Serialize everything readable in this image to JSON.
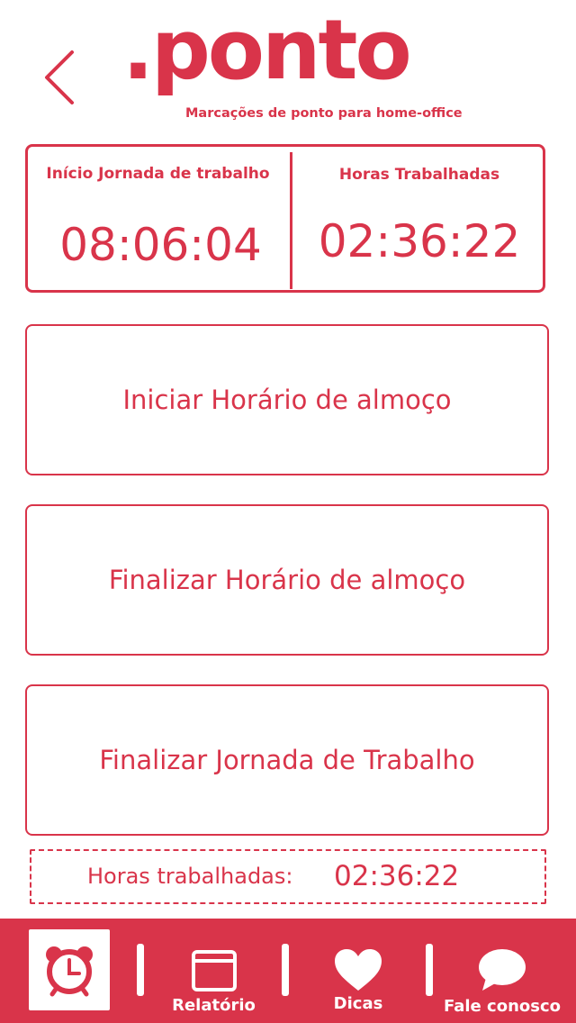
{
  "header": {
    "logo_text": ".ponto",
    "tagline": "Marcações de ponto para home-office"
  },
  "stats": {
    "start_label": "Início Jornada de trabalho",
    "start_value": "08:06:04",
    "worked_label": "Horas Trabalhadas",
    "worked_value": "02:36:22"
  },
  "actions": {
    "start_lunch": "Iniciar Horário de almoço",
    "end_lunch": "Finalizar Horário de almoço",
    "end_workday": "Finalizar Jornada de Trabalho"
  },
  "summary": {
    "label": "Horas trabalhadas:",
    "value": "02:36:22"
  },
  "nav": {
    "items": [
      {
        "icon": "alarm-clock-icon",
        "label": ""
      },
      {
        "icon": "window-icon",
        "label": "Relatório"
      },
      {
        "icon": "heart-icon",
        "label": "Dicas"
      },
      {
        "icon": "chat-bubble-icon",
        "label": "Fale conosco"
      }
    ]
  },
  "colors": {
    "brand": "#d9344a",
    "background": "#ffffff"
  }
}
